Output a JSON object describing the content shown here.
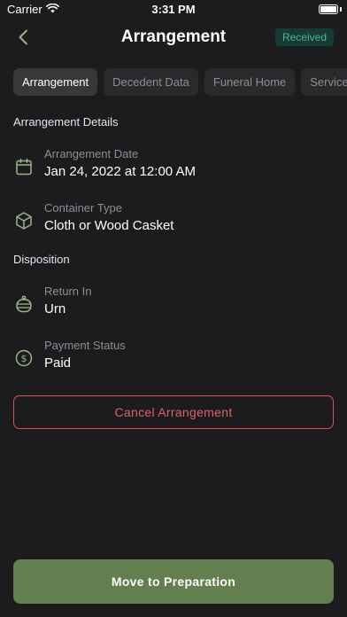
{
  "status_bar": {
    "carrier": "Carrier",
    "time": "3:31 PM"
  },
  "nav": {
    "title": "Arrangement",
    "status_chip": "Received"
  },
  "tabs": [
    {
      "label": "Arrangement",
      "active": true
    },
    {
      "label": "Decedent Data",
      "active": false
    },
    {
      "label": "Funeral Home",
      "active": false
    },
    {
      "label": "Services",
      "active": false
    }
  ],
  "sections": {
    "details_title": "Arrangement Details",
    "disposition_title": "Disposition"
  },
  "fields": {
    "arrangement_date": {
      "label": "Arrangement Date",
      "value": "Jan 24, 2022 at 12:00 AM",
      "icon": "calendar-icon"
    },
    "container_type": {
      "label": "Container Type",
      "value": "Cloth or Wood Casket",
      "icon": "box-icon"
    },
    "return_in": {
      "label": "Return In",
      "value": "Urn",
      "icon": "urn-icon"
    },
    "payment_status": {
      "label": "Payment Status",
      "value": "Paid",
      "icon": "dollar-icon"
    }
  },
  "buttons": {
    "cancel": "Cancel Arrangement",
    "primary": "Move to Preparation"
  },
  "colors": {
    "background": "#1c1c1e",
    "accent_green": "#647f4f",
    "icon_green": "#9bb38a",
    "chip_text": "#4fb3a2",
    "danger": "#e06166"
  }
}
